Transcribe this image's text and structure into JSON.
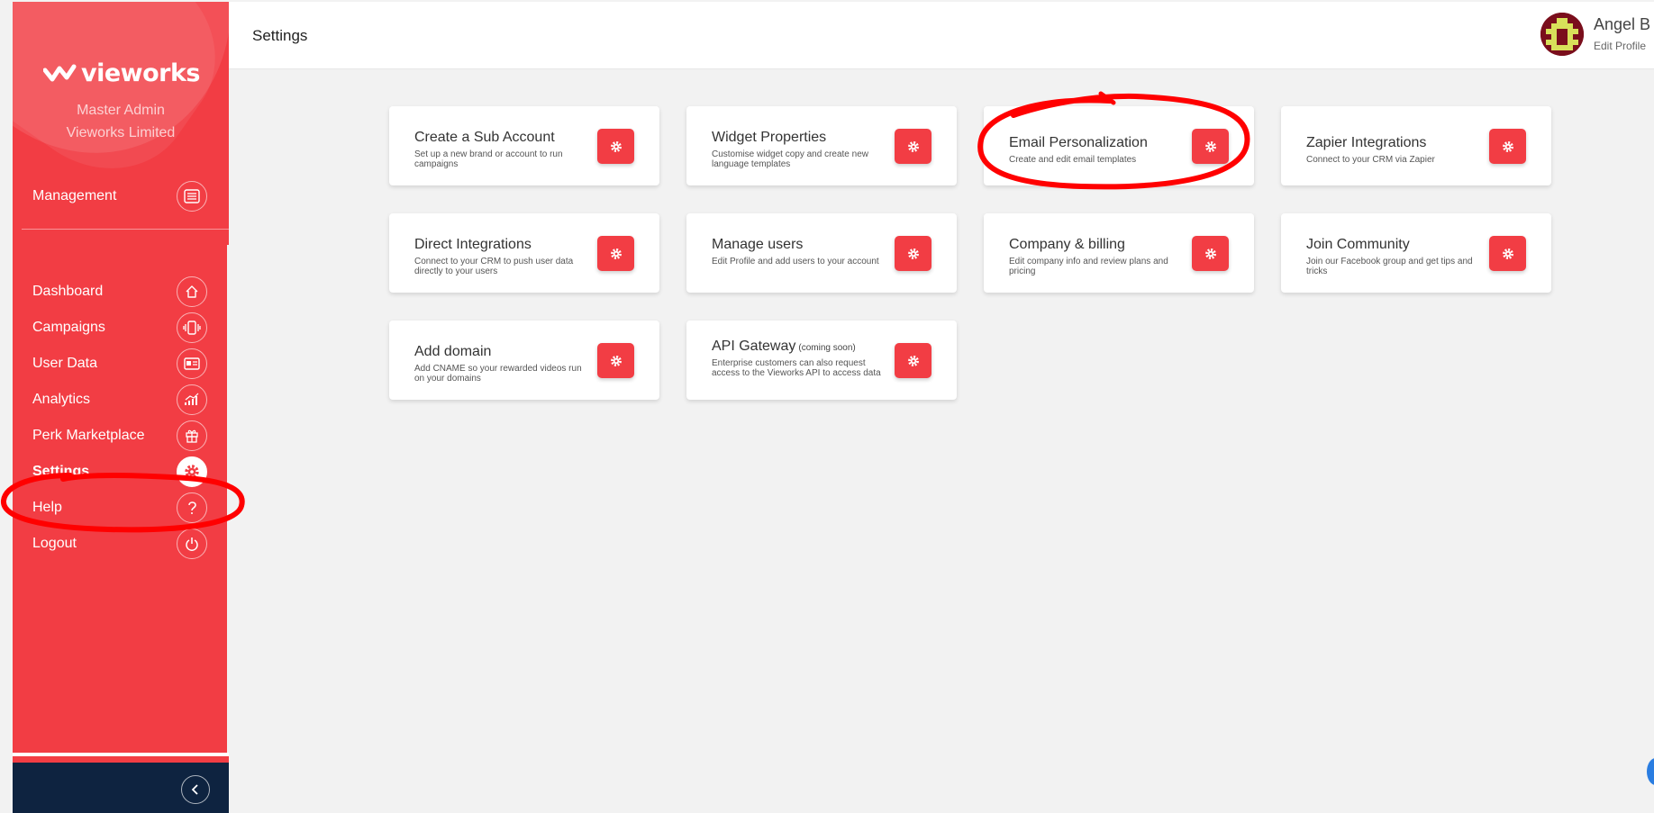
{
  "brand": {
    "name": "vieworks",
    "role": "Master Admin",
    "org": "Vieworks Limited"
  },
  "sidebar": {
    "management": {
      "label": "Management",
      "icon": "list-icon"
    },
    "items": [
      {
        "label": "Dashboard",
        "icon": "home-icon",
        "active": false
      },
      {
        "label": "Campaigns",
        "icon": "phone-vibrate-icon",
        "active": false
      },
      {
        "label": "User Data",
        "icon": "id-card-icon",
        "active": false
      },
      {
        "label": "Analytics",
        "icon": "chart-icon",
        "active": false
      },
      {
        "label": "Perk Marketplace",
        "icon": "gift-icon",
        "active": false
      },
      {
        "label": "Settings",
        "icon": "gear-icon",
        "active": true
      },
      {
        "label": "Help",
        "icon": "question-icon",
        "active": false
      },
      {
        "label": "Logout",
        "icon": "power-icon",
        "active": false
      }
    ],
    "collapse_icon": "chevron-left-icon"
  },
  "header": {
    "title": "Settings"
  },
  "user": {
    "name": "Angel B",
    "edit_label": "Edit Profile"
  },
  "cards": [
    {
      "title": "Create a Sub Account",
      "desc": "Set up a new brand or account to run campaigns",
      "icon": "gear-icon"
    },
    {
      "title": "Widget Properties",
      "desc": "Customise widget copy and create new language templates",
      "icon": "gear-icon"
    },
    {
      "title": "Email Personalization",
      "desc": "Create and edit email templates",
      "icon": "gear-icon"
    },
    {
      "title": "Zapier Integrations",
      "desc": "Connect to your CRM via Zapier",
      "icon": "gear-icon"
    },
    {
      "title": "Direct Integrations",
      "desc": "Connect to your CRM to push user data directly to your users",
      "icon": "gear-icon"
    },
    {
      "title": "Manage users",
      "desc": "Edit Profile and add users to your account",
      "icon": "gear-icon"
    },
    {
      "title": "Company & billing",
      "desc": "Edit company info and review plans and pricing",
      "icon": "gear-icon"
    },
    {
      "title": "Join Community",
      "desc": "Join our Facebook group and get tips and tricks",
      "icon": "gear-icon"
    },
    {
      "title": "Add domain",
      "desc": "Add CNAME so your rewarded videos run on your domains",
      "icon": "gear-icon"
    },
    {
      "title": "API Gateway",
      "title_note": "(coming soon)",
      "desc": "Enterprise customers can also request access to the Vieworks API to access data",
      "icon": "gear-icon"
    }
  ],
  "colors": {
    "accent": "#f23d44",
    "sidebar_footer": "#0e2340",
    "annotation": "#ff0000"
  }
}
